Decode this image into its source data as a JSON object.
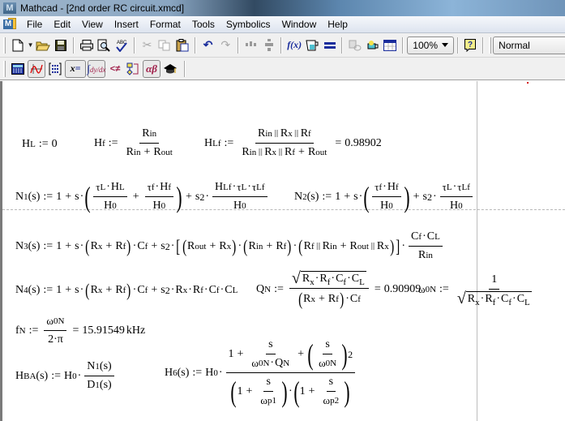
{
  "window": {
    "title": "Mathcad - [2nd order RC circuit.xmcd]"
  },
  "menubar": {
    "items": [
      "File",
      "Edit",
      "View",
      "Insert",
      "Format",
      "Tools",
      "Symbolics",
      "Window",
      "Help"
    ],
    "mnemonics": [
      "F",
      "E",
      "V",
      "I",
      "o",
      "T",
      "S",
      "W",
      "H"
    ]
  },
  "toolbar_standard": {
    "buttons": [
      "new-document",
      "new-dropdown",
      "open",
      "save",
      "print",
      "print-preview",
      "spell-check",
      "cut",
      "copy",
      "paste",
      "undo",
      "redo",
      "align-across",
      "align-down",
      "insert-function",
      "insert-unit",
      "calculate",
      "insert-hyperlink",
      "component-wizard",
      "run-mathconnex",
      "help"
    ],
    "zoom_value": "100%",
    "style_value": "Normal"
  },
  "toolbar_math": {
    "buttons": [
      "calculator-toolbar",
      "graph-toolbar",
      "matrix-toolbar",
      "evaluation-toolbar",
      "calculus-toolbar",
      "boolean-toolbar",
      "programming-toolbar",
      "greek-toolbar",
      "symbolic-toolbar"
    ]
  },
  "worksheet": {
    "assign": ":=",
    "equals": "=",
    "plus": "+",
    "eq_HL": {
      "lhs": "H",
      "lhs_sub": "L",
      "rhs": "0"
    },
    "eq_Hf": {
      "lhs": "H",
      "lhs_sub": "f"
    },
    "eq_HLf": {
      "lhs": "H",
      "lhs_sub": "Lf",
      "result": "0.98902"
    },
    "eq_N1": {
      "lhs": "N",
      "lhs_sub": "1",
      "arg": "(s)"
    },
    "eq_N2": {
      "lhs": "N",
      "lhs_sub": "2",
      "arg": "(s)"
    },
    "eq_N3": {
      "lhs": "N",
      "lhs_sub": "3",
      "arg": "(s)"
    },
    "eq_N4": {
      "lhs": "N",
      "lhs_sub": "4",
      "arg": "(s)"
    },
    "eq_QN": {
      "lhs": "Q",
      "lhs_sub": "N",
      "result": "0.90909"
    },
    "eq_w0N": {
      "lhs": "ω",
      "lhs_sub": "0N",
      "numerator": "1"
    },
    "eq_fN": {
      "lhs": "f",
      "lhs_sub": "N",
      "den": "2·π",
      "result": "15.91549",
      "unit": "kHz"
    },
    "eq_HBA": {
      "lhs": "H",
      "lhs_sub": "BA",
      "arg": "(s)"
    },
    "eq_H6": {
      "lhs": "H",
      "lhs_sub": "6",
      "arg": "(s)"
    },
    "sym": {
      "one": "1",
      "s": "s",
      "two": "2",
      "dot": "·",
      "R": "R",
      "C": "C",
      "H": "H",
      "tau": "τ",
      "omega": "ω",
      "N": "N",
      "D": "D",
      "Q": "Q",
      "in": "in",
      "out": "out",
      "x": "x",
      "f": "f",
      "L": "L",
      "Lf": "Lf",
      "0": "0",
      "0N": "0N",
      "N_sub": "N",
      "p1": "p1",
      "p2": "p2",
      "1_sub": "1",
      "arg_s": "(s)",
      "parallel": "‖"
    }
  }
}
